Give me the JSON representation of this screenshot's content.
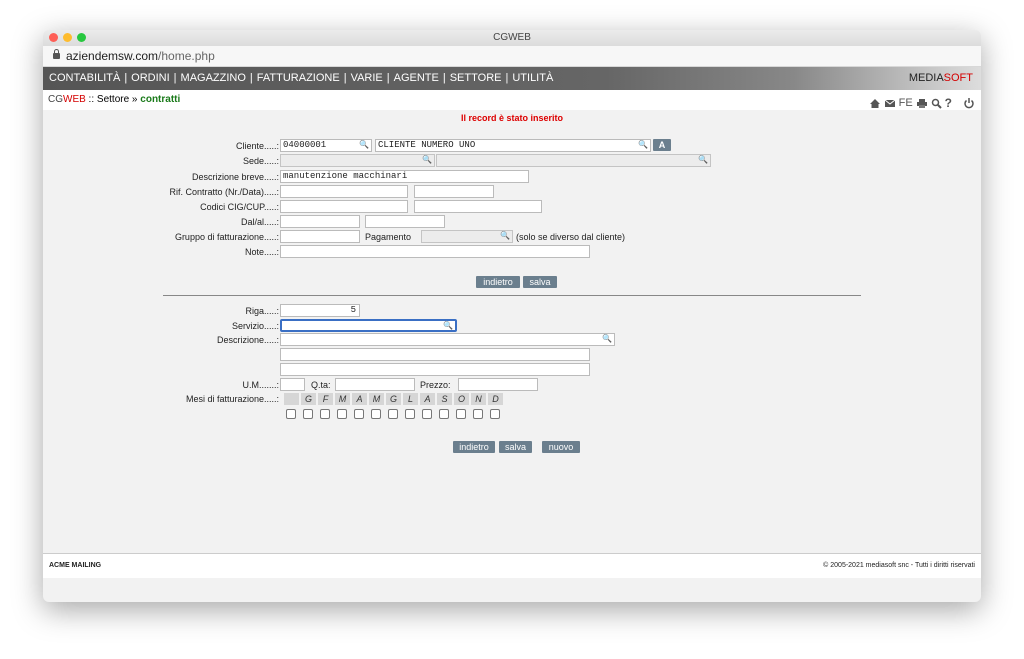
{
  "window": {
    "title": "CGWEB"
  },
  "address": {
    "host": "aziendemsw.com",
    "path": "/home.php"
  },
  "menu": [
    "CONTABILITÀ",
    "ORDINI",
    "MAGAZZINO",
    "FATTURAZIONE",
    "VARIE",
    "AGENTE",
    "SETTORE",
    "UTILITÀ"
  ],
  "brand": {
    "media": "MEDIA",
    "soft": "SOFT"
  },
  "breadcrumb": {
    "cg": "CG",
    "web": "WEB",
    "sep": " :: ",
    "section": "Settore",
    "arrow": " » ",
    "current": "contratti"
  },
  "toolbar": {
    "fe": "FE",
    "help": "?"
  },
  "message": "Il record è stato inserito",
  "form": {
    "cliente_label": "Cliente.....:",
    "cliente_code": "04000001",
    "cliente_name": "CLIENTE NUMERO UNO",
    "a_button": "A",
    "sede_label": "Sede.....:",
    "descrizione_breve_label": "Descrizione breve.....:",
    "descrizione_breve_value": "manutenzione macchinari",
    "rif_contratto_label": "Rif. Contratto (Nr./Data).....:",
    "codici_label": "Codici CIG/CUP.....:",
    "dal_al_label": "Dal/al.....:",
    "gruppo_label": "Gruppo di fatturazione.....:",
    "pagamento_label": "Pagamento",
    "pagamento_note": "(solo se diverso dal cliente)",
    "note_label": "Note.....:",
    "back_button": "indietro",
    "save_button": "salva"
  },
  "riga": {
    "riga_label": "Riga.....:",
    "riga_value": "5",
    "servizio_label": "Servizio.....:",
    "descrizione_label": "Descrizione.....:",
    "um_label": "U.M.......:",
    "qta_label": "Q.ta:",
    "prezzo_label": "Prezzo:",
    "mesi_label": "Mesi di fatturazione.....:",
    "months": [
      "G",
      "F",
      "M",
      "A",
      "M",
      "G",
      "L",
      "A",
      "S",
      "O",
      "N",
      "D"
    ],
    "back_button": "indietro",
    "save_button": "salva",
    "new_button": "nuovo"
  },
  "footer": {
    "left": "ACME MAILING",
    "right": "© 2005-2021 mediasoft snc - Tutti i diritti riservati"
  }
}
